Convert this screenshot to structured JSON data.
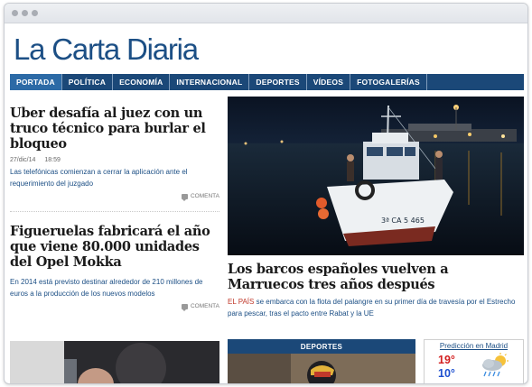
{
  "site": {
    "logo": "La Carta Diaria"
  },
  "nav": {
    "items": [
      {
        "label": "PORTADA",
        "active": true
      },
      {
        "label": "POLÍTICA",
        "active": false
      },
      {
        "label": "ECONOMÍA",
        "active": false
      },
      {
        "label": "INTERNACIONAL",
        "active": false
      },
      {
        "label": "DEPORTES",
        "active": false
      },
      {
        "label": "VÍDEOS",
        "active": false
      },
      {
        "label": "FOTOGALERÍAS",
        "active": false
      }
    ]
  },
  "articles": [
    {
      "title": "Uber desafía al juez con un truco técnico para burlar el bloqueo",
      "date": "27/dic/14",
      "time": "18:59",
      "summary": "Las telefónicas comienzan a cerrar la aplicación ante el requerimiento del juzgado",
      "comment_label": "COMENTA"
    },
    {
      "title": "Figueruelas fabricará el año que viene 80.000 unidades del Opel Mokka",
      "summary": "En 2014 está previsto destinar alrededor de 210 millones de euros a la producción de los nuevos modelos",
      "comment_label": "COMENTA"
    }
  ],
  "feature": {
    "title": "Los barcos españoles vuelven a Marruecos tres años después",
    "summary_source": "EL PAÍS",
    "summary_rest": " se embarca con la flota del palangre en su primer día de travesía por el Estrecho para pescar, tras el pacto entre Rabat y la UE",
    "boat_registration": "3ª CA 5 465"
  },
  "deportes": {
    "header": "DEPORTES"
  },
  "weather": {
    "title": "Predicción en Madrid",
    "max": "19°",
    "min": "10°",
    "icon": "rain-cloud-sun-icon"
  },
  "colors": {
    "brand_blue": "#1c4f85",
    "nav_bg": "#1b4878",
    "nav_active": "#2c6aa6",
    "temp_max": "#d31f1f",
    "temp_min": "#1d4fcf"
  }
}
